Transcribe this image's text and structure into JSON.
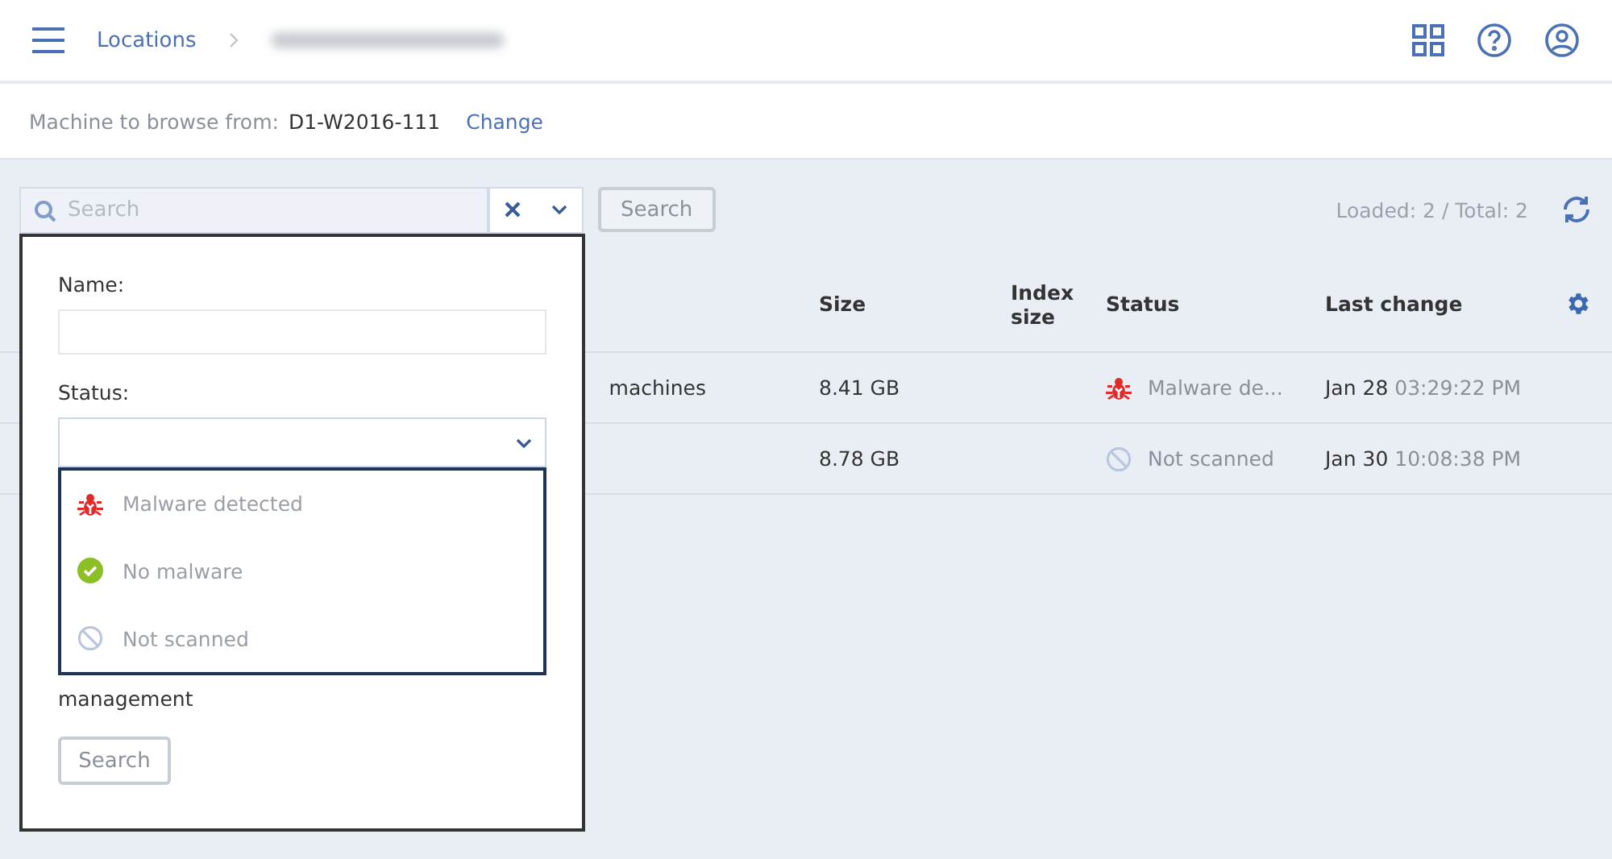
{
  "header": {
    "breadcrumb": "Locations"
  },
  "machine_bar": {
    "label": "Machine to browse from:",
    "machine": "D1-W2016-111",
    "change_link": "Change"
  },
  "toolbar": {
    "search": {
      "placeholder": "Search"
    },
    "search_button": "Search",
    "counter": "Loaded: 2 / Total: 2"
  },
  "table": {
    "columns": [
      "",
      "Size",
      "Index size",
      "Status",
      "Last change"
    ],
    "rows": [
      {
        "column_1": "machines",
        "size": "8.41 GB",
        "status": {
          "kind": "malware",
          "text": "Malware de..."
        },
        "date": "Jan 28",
        "time": "03:29:22 PM"
      },
      {
        "column_1": "",
        "size": "8.78 GB",
        "status": {
          "kind": "not_scanned",
          "text": "Not scanned"
        },
        "date": "Jan 30",
        "time": "10:08:38 PM"
      }
    ]
  },
  "filter_panel": {
    "name_label": "Name:",
    "status_label": "Status:",
    "status_options": [
      {
        "kind": "malware",
        "label": "Malware detected"
      },
      {
        "kind": "clean",
        "label": "No malware"
      },
      {
        "kind": "not_scanned",
        "label": "Not scanned"
      }
    ],
    "checkbox_label": "management",
    "search_button": "Search"
  }
}
